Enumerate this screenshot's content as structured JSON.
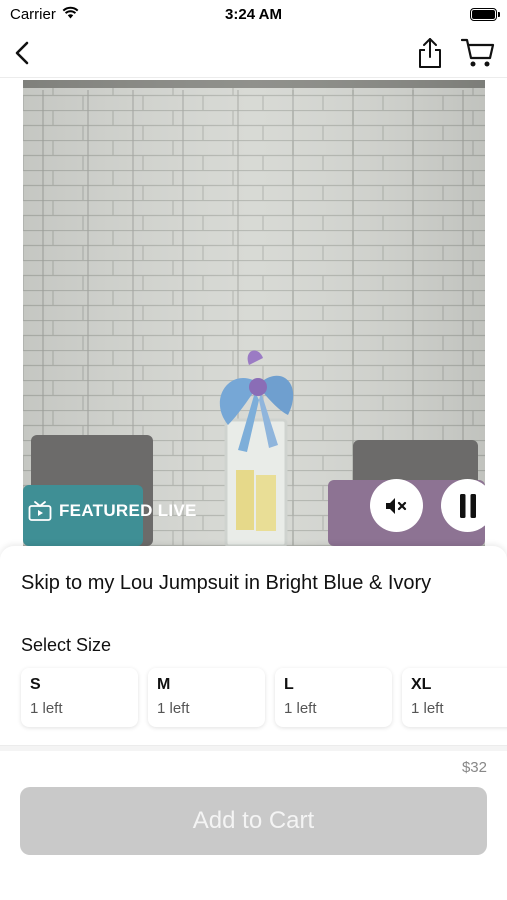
{
  "status_bar": {
    "carrier": "Carrier",
    "time": "3:24 AM"
  },
  "nav": {
    "back_icon": "chevron-left-icon",
    "share_icon": "share-icon",
    "cart_icon": "cart-icon"
  },
  "video": {
    "badge": "FEATURED LIVE",
    "mute_icon": "mute-icon",
    "pause_icon": "pause-icon"
  },
  "product": {
    "title": "Skip to my Lou Jumpsuit in Bright Blue & Ivory",
    "select_size_label": "Select Size",
    "sizes": [
      {
        "label": "S",
        "stock": "1 left"
      },
      {
        "label": "M",
        "stock": "1 left"
      },
      {
        "label": "L",
        "stock": "1 left"
      },
      {
        "label": "XL",
        "stock": "1 left"
      }
    ],
    "price": "$32",
    "add_to_cart_label": "Add to Cart"
  },
  "colors": {
    "button_disabled": "#c9c9c9",
    "video_bg": "#c9cbc6"
  }
}
